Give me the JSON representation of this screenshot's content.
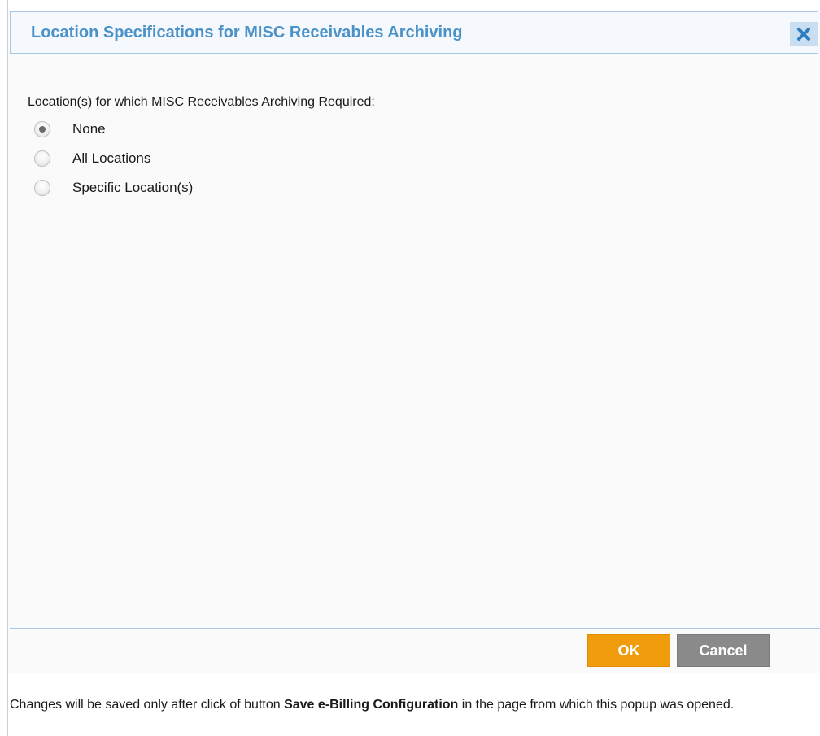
{
  "dialog": {
    "title": "Location Specifications for MISC Receivables Archiving",
    "close_icon": "close-icon"
  },
  "question": {
    "label": "Location(s) for which MISC Receivables Archiving Required:",
    "options": [
      {
        "label": "None",
        "selected": true
      },
      {
        "label": "All Locations",
        "selected": false
      },
      {
        "label": "Specific Location(s)",
        "selected": false
      }
    ]
  },
  "buttons": {
    "ok_label": "OK",
    "cancel_label": "Cancel"
  },
  "note": {
    "before": "Changes will be saved only after click of button ",
    "emphasis": "Save e-Billing Configuration",
    "after": " in the page from which this popup was opened."
  },
  "colors": {
    "title": "#4a92c8",
    "header_border": "#a9c8e4",
    "ok": "#f19c0c",
    "cancel": "#8a8a8a",
    "close_bg": "#c9dff1"
  }
}
